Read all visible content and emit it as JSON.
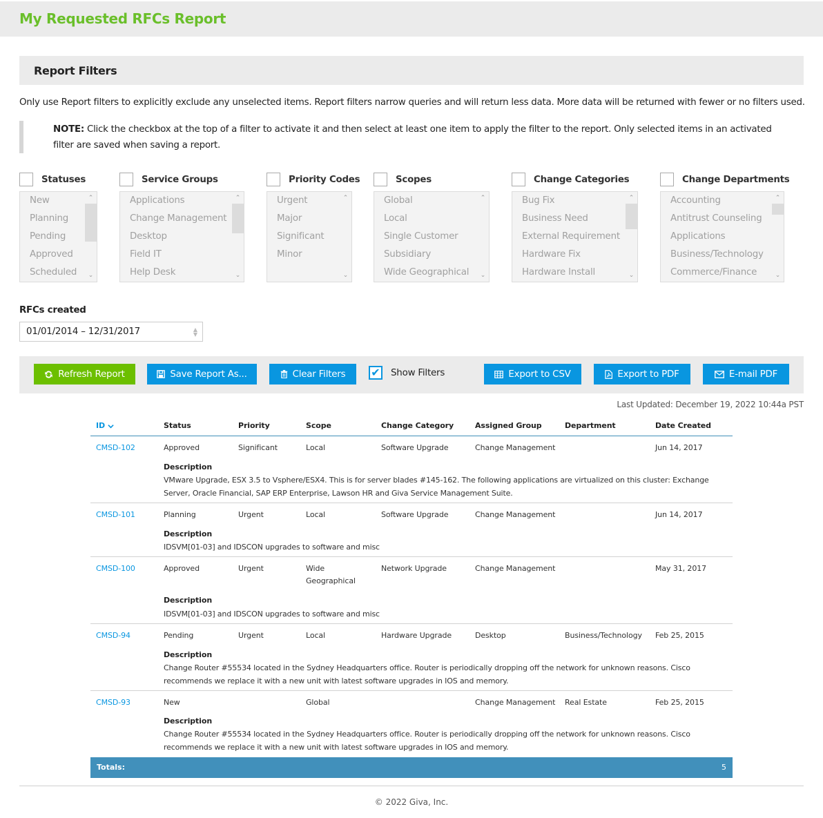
{
  "page": {
    "title": "My Requested RFCs Report"
  },
  "filters": {
    "title": "Report Filters",
    "intro": "Only use Report filters to explicitly exclude any unselected items. Report filters narrow queries and will return less data. More data will be returned with fewer or no filters used.",
    "note_label": "NOTE:",
    "note_text": " Click the checkbox at the top of a filter to activate it and then select at least one item to apply the filter to the report. Only selected items in an activated filter are saved when saving a report.",
    "groups": [
      {
        "label": "Statuses",
        "checked": false,
        "options": [
          "New",
          "Planning",
          "Pending",
          "Approved",
          "Scheduled"
        ]
      },
      {
        "label": "Service Groups",
        "checked": false,
        "options": [
          "Applications",
          "Change Management",
          "Desktop",
          "Field IT",
          "Help Desk"
        ]
      },
      {
        "label": "Priority Codes",
        "checked": false,
        "options": [
          "Urgent",
          "Major",
          "Significant",
          "Minor"
        ]
      },
      {
        "label": "Scopes",
        "checked": false,
        "options": [
          "Global",
          "Local",
          "Single Customer",
          "Subsidiary",
          "Wide Geographical"
        ]
      },
      {
        "label": "Change Categories",
        "checked": false,
        "options": [
          "Bug Fix",
          "Business Need",
          "External Requirement",
          "Hardware Fix",
          "Hardware Install"
        ]
      },
      {
        "label": "Change Departments",
        "checked": false,
        "options": [
          "Accounting",
          "Antitrust Counseling",
          "Applications",
          "Business/Technology",
          "Commerce/Finance"
        ]
      }
    ],
    "rfcs_created_label": "RFCs created",
    "rfcs_created_value": "01/01/2014 – 12/31/2017"
  },
  "toolbar": {
    "refresh": "Refresh Report",
    "save": "Save Report As...",
    "clear": "Clear Filters",
    "show_filters": "Show Filters",
    "show_filters_checked": true,
    "export_csv": "Export to CSV",
    "export_pdf": "Export to PDF",
    "email_pdf": "E-mail PDF",
    "colors": {
      "green": "#6cbf00",
      "blue": "#0996e0"
    }
  },
  "last_updated": "Last Updated: December 19, 2022 10:44a PST",
  "table": {
    "columns": [
      "ID",
      "Status",
      "Priority",
      "Scope",
      "Change Category",
      "Assigned Group",
      "Department",
      "Date Created"
    ],
    "sort_indicator": "chevron-down",
    "description_label": "Description",
    "rows": [
      {
        "id": "CMSD-102",
        "status": "Approved",
        "priority": "Significant",
        "scope": "Local",
        "category": "Software Upgrade",
        "group": "Change Management",
        "department": "",
        "date": "Jun 14, 2017",
        "description": "VMware Upgrade, ESX 3.5 to Vsphere/ESX4. This is for server blades #145-162. The following applications are virtualized on this cluster: Exchange Server, Oracle Financial, SAP ERP Enterprise, Lawson HR and Giva Service Management Suite."
      },
      {
        "id": "CMSD-101",
        "status": "Planning",
        "priority": "Urgent",
        "scope": "Local",
        "category": "Software Upgrade",
        "group": "Change Management",
        "department": "",
        "date": "Jun 14, 2017",
        "description": "IDSVM[01-03] and IDSCON upgrades to software and misc"
      },
      {
        "id": "CMSD-100",
        "status": "Approved",
        "priority": "Urgent",
        "scope": "Wide Geographical",
        "category": "Network Upgrade",
        "group": "Change Management",
        "department": "",
        "date": "May 31, 2017",
        "description": "IDSVM[01-03] and IDSCON upgrades to software and misc"
      },
      {
        "id": "CMSD-94",
        "status": "Pending",
        "priority": "Urgent",
        "scope": "Local",
        "category": "Hardware Upgrade",
        "group": "Desktop",
        "department": "Business/Technology",
        "date": "Feb 25, 2015",
        "description": "Change Router #55534 located in the Sydney Headquarters office. Router is periodically dropping off the network for unknown reasons. Cisco recommends we replace it with a new unit with latest software upgrades in IOS and memory."
      },
      {
        "id": "CMSD-93",
        "status": "New",
        "priority": "",
        "scope": "Global",
        "category": "",
        "group": "Change Management",
        "department": "Real Estate",
        "date": "Feb 25, 2015",
        "description": "Change Router #55534 located in the Sydney Headquarters office. Router is periodically dropping off the network for unknown reasons. Cisco recommends we replace it with a new unit with latest software upgrades in IOS and memory."
      }
    ],
    "totals_label": "Totals:",
    "totals_value": "5"
  },
  "footer": "© 2022 Giva, Inc."
}
